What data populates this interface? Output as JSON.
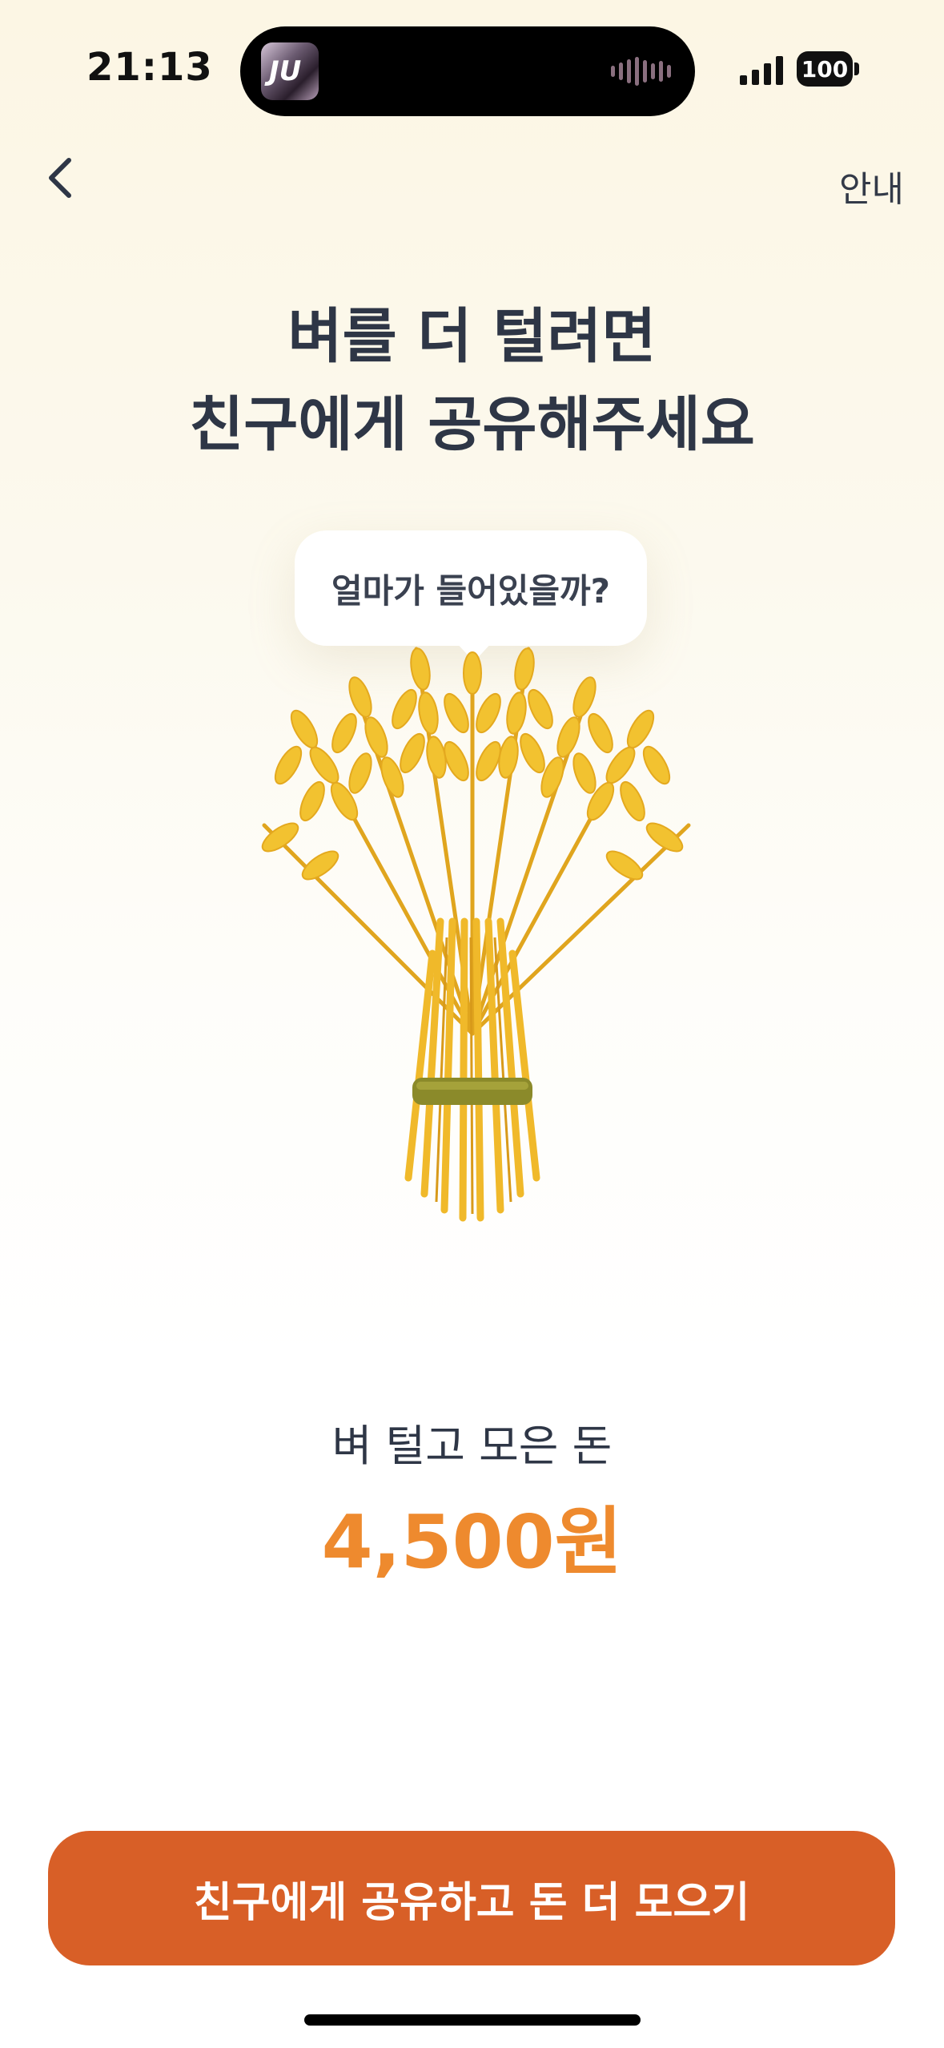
{
  "status_bar": {
    "time": "21:13",
    "battery": "100",
    "now_playing_art_text": "JU"
  },
  "nav": {
    "back_icon": "chevron-left-icon",
    "guide_label": "안내"
  },
  "headline": {
    "line1": "벼를 더 털려면",
    "line2": "친구에게 공유해주세요"
  },
  "bubble": {
    "text": "얼마가 들어있을까?"
  },
  "illustration": {
    "name": "wheat-bundle",
    "color": "#F2C230"
  },
  "collected": {
    "label": "벼 털고 모은 돈",
    "amount": "4,500원"
  },
  "cta": {
    "label": "친구에게 공유하고 돈 더 모으기",
    "color": "#D85F27"
  },
  "colors": {
    "accent_amount": "#EE8A2E",
    "text_primary": "#2E3646"
  }
}
